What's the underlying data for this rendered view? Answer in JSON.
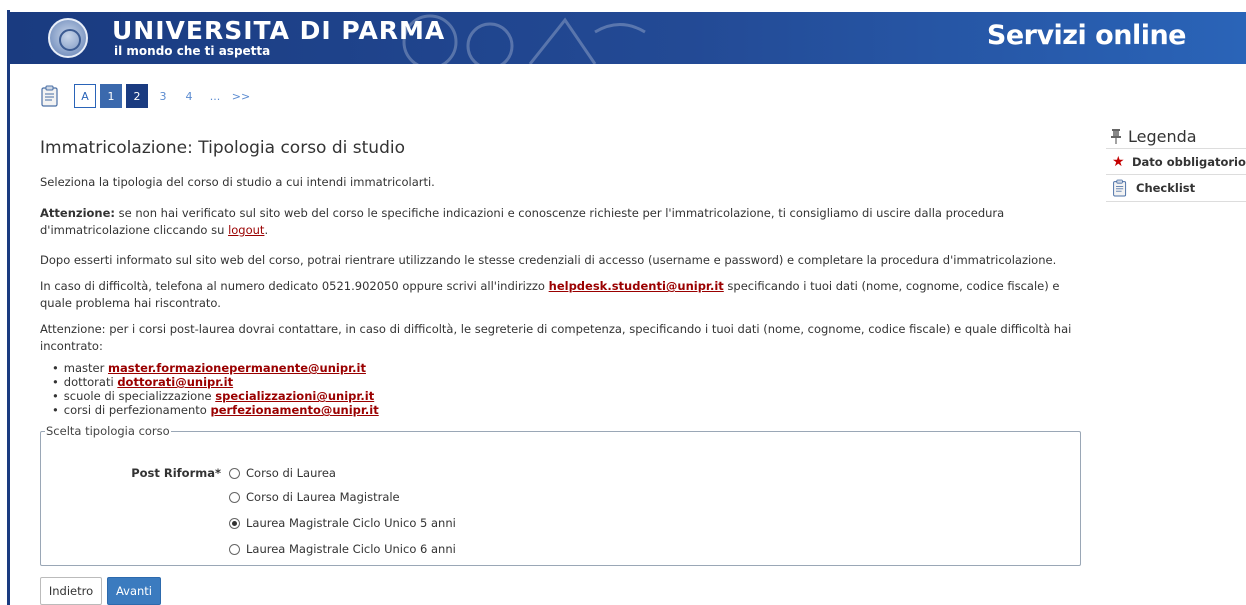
{
  "header": {
    "university": "UNIVERSITA DI PARMA",
    "motto": "il mondo che ti aspetta",
    "service": "Servizi online",
    "colors": {
      "bar_dark": "#1a3b80",
      "bar_light": "#2a64b8"
    }
  },
  "steps": {
    "clip_icon": "checklist-icon",
    "items": [
      "A",
      "1",
      "2",
      "3",
      "4",
      "...",
      ">>"
    ]
  },
  "main": {
    "title": "Immatricolazione: Tipologia corso di studio",
    "intro": "Seleziona la tipologia del corso di studio a cui intendi immatricolarti.",
    "warning_label": "Attenzione:",
    "warning_text": " se non hai verificato sul sito web del corso le specifiche indicazioni e conoscenze richieste per l'immatricolazione, ti consigliamo di uscire dalla procedura d'immatricolazione cliccando su ",
    "logout": "logout",
    "warning_end": ".",
    "after_info": "Dopo esserti informato sul sito web del corso, potrai rientrare utilizzando le stesse credenziali di accesso (username e password) e completare la procedura d'immatricolazione.",
    "difficulty_pre": "In caso di difficoltà, telefona al numero dedicato 0521.902050 oppure scrivi all'indirizzo ",
    "helpdesk": "helpdesk.studenti@unipr.it",
    "difficulty_post": " specificando i tuoi dati (nome, cognome, codice fiscale) e quale problema hai riscontrato.",
    "postlaurea": "Attenzione: per i corsi post-laurea dovrai contattare, in caso di difficoltà, le segreterie di competenza, specificando i tuoi dati (nome, cognome, codice fiscale) e quale difficoltà hai incontrato:",
    "contacts": [
      {
        "label": "master ",
        "email": "master.formazionepermanente@unipr.it"
      },
      {
        "label": "dottorati ",
        "email": "dottorati@unipr.it"
      },
      {
        "label": "scuole di specializzazione ",
        "email": "specializzazioni@unipr.it"
      },
      {
        "label": "corsi di perfezionamento ",
        "email": "perfezionamento@unipr.it"
      }
    ]
  },
  "form": {
    "legend": "Scelta tipologia corso",
    "label": "Post Riforma*",
    "options": [
      {
        "label": "Corso di Laurea",
        "checked": false
      },
      {
        "label": "Corso di Laurea Magistrale",
        "checked": false
      },
      {
        "label": "Laurea Magistrale Ciclo Unico 5 anni",
        "checked": true
      },
      {
        "label": "Laurea Magistrale Ciclo Unico 6 anni",
        "checked": false
      }
    ]
  },
  "buttons": {
    "back": "Indietro",
    "next": "Avanti"
  },
  "legend": {
    "title": "Legenda",
    "items": [
      {
        "icon": "star-icon",
        "label": "Dato obbligatorio"
      },
      {
        "icon": "checklist-icon",
        "label": "Checklist"
      }
    ]
  }
}
